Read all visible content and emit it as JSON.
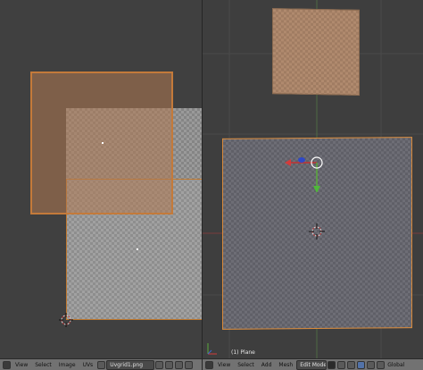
{
  "uv_editor": {
    "header": {
      "menus": [
        "View",
        "Select",
        "Image",
        "UVs"
      ],
      "image_name": "Uvgrid1.png"
    }
  },
  "viewport": {
    "object_info": "(1) Plane",
    "header": {
      "menus": [
        "View",
        "Select",
        "Add",
        "Mesh"
      ],
      "mode": "Edit Mode",
      "orientation": "Global"
    }
  },
  "colors": {
    "selection_orange": "#e07a28",
    "x_axis": "#d23c3c",
    "y_axis": "#5a9a3c",
    "z_axis": "#3c6ad2"
  },
  "icons": [
    "editor-type-icon",
    "cursor-icon",
    "pivot-icon",
    "snap-icon",
    "proportional-icon",
    "layer-icon"
  ]
}
